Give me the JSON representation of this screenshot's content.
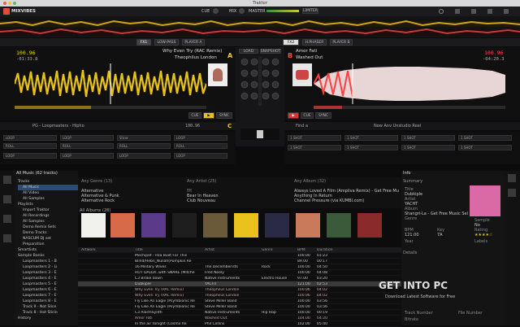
{
  "titlebar": {
    "title": "Traktor"
  },
  "topbar": {
    "logo": "MIXVIBES",
    "cue_label": "CUE",
    "mix_label": "MIX",
    "master_label": "MASTER",
    "limiter_label": "LIMITER"
  },
  "fx": {
    "fx1": "FX1",
    "fx2": "FX2",
    "fx1_effect": "LOW-PASS",
    "fx1_target": "PLAYER A",
    "fx2_effect": "H.PHASER",
    "fx2_target": "PLAYER B"
  },
  "deckA": {
    "title": "Why Even Try (RAC Remix)",
    "artist": "Theophilus London",
    "bpm": "100.96",
    "time_elapsed": "-01:33.8",
    "time_remain": "-01:33.8",
    "letter": "A",
    "cue": "CUE",
    "sync": "SYNC"
  },
  "deckB": {
    "title": "Amor Fati",
    "artist": "Washed Out",
    "bpm": "100.96",
    "time_remain": "-04:20.3",
    "letter": "B",
    "cue": "CUE",
    "sync": "SYNC"
  },
  "mixer": {
    "load": "LOAD",
    "snapshot": "SNAPSHOT",
    "letter_c": "C"
  },
  "deckC": {
    "source": "PG - Loopmasters - Hipho",
    "bpm": "100.96"
  },
  "deckD": {
    "source": "Find a",
    "label": "Now Anv Unstudio Reel"
  },
  "pads": {
    "loop": "LOOP",
    "roll": "ROLL",
    "slicer": "Slicer",
    "one_shot": "1 SHOT"
  },
  "browser": {
    "header": "All Music (62 tracks)",
    "genre_header": "Any Genre (13)",
    "artist_header": "Any Artist (25)",
    "album_header": "Any Album (32)",
    "albums_label": "All Albums (28)",
    "info_header": "Info"
  },
  "tree": [
    "Tracks",
    "All Music",
    "All Video",
    "All Samples",
    "Playlists",
    "Import Traktor",
    "All Recordings",
    "All Samples",
    "Demo Remix Sets",
    "Demo Tracks",
    "NASCUM DJ set",
    "Preparation",
    "Smartlists",
    "Sample Banks",
    "Loopmasters 1 - B",
    "Loopmasters 2 - Li",
    "Loopmasters 3 - E",
    "Loopmasters 4 - E",
    "Loopmasters 5 - E",
    "Loopmasters 6 - E",
    "Loopmasters 7 - E",
    "Loopmasters 8 - E",
    "Track 9 - Not Slice",
    "Track 8 - Hot Slicin",
    "History"
  ],
  "sidebar_icons": [
    "Collection",
    "Music",
    "Explorer",
    "Video",
    "Playlists",
    "Sounds",
    "Timeline",
    "Podcast"
  ],
  "genres": [
    "Alternative",
    "Alternative & Punk",
    "Alternative Rock"
  ],
  "artists": [
    "!!!",
    "Bear In Heaven",
    "Club Nouveau"
  ],
  "albums": [
    "Always Loved A Film (Ampliva Remix) - Get Free Mu",
    "Anything In Return",
    "Channel Pressure (via KUMBI.com)"
  ],
  "columns": {
    "artwork": "Artwork",
    "title": "Title",
    "artist": "Artist",
    "genre": "Genre",
    "bpm": "BPM",
    "duration": "Duration"
  },
  "tracks": [
    {
      "title": "Mochipet - Rza Built For This",
      "artist": "",
      "genre": "",
      "bpm": "100.00",
      "duration": "01:23"
    },
    {
      "title": "Blind/Hebn_Nullah(Pumpkin Re",
      "artist": "",
      "genre": "",
      "bpm": "89.00",
      "duration": "00:17"
    },
    {
      "title": "16 Military Wives",
      "artist": "The Decemberists",
      "genre": "Rock",
      "bpm": "100.00",
      "duration": "04:50"
    },
    {
      "title": "HOT DALUX..with SNARE (Mitche",
      "artist": "Fred Neely",
      "genre": "",
      "bpm": "100.00",
      "duration": "04:08"
    },
    {
      "title": "C3 Broke down",
      "artist": "Native Instruments",
      "genre": "Electro House",
      "bpm": "97.00",
      "duration": "03:20"
    },
    {
      "title": "Dubkiple",
      "artist": "YACHT",
      "genre": "",
      "bpm": "121.00",
      "duration": "02:53"
    },
    {
      "title": "Why Even Try (RAC Remix)",
      "artist": "Theophilus London",
      "genre": "",
      "bpm": "100.96",
      "duration": "04:02"
    },
    {
      "title": "Why Even Try (RAC Remix)",
      "artist": "Theophilus London",
      "genre": "",
      "bpm": "100.96",
      "duration": "04:02"
    },
    {
      "title": "Fly Like An Eagle (Psymbionic Re",
      "artist": "Steve Miller Band",
      "genre": "",
      "bpm": "100.00",
      "duration": "03:56"
    },
    {
      "title": "Fly Like An Eagle (Psymbionic Re",
      "artist": "Steve Miller Band",
      "genre": "",
      "bpm": "100.00",
      "duration": "03:56"
    },
    {
      "title": "C3 AlarmSynth",
      "artist": "Native Instruments",
      "genre": "Hip Hop",
      "bpm": "100.00",
      "duration": "00:19"
    },
    {
      "title": "Amor Fati",
      "artist": "Washed Out",
      "genre": "",
      "bpm": "104.00",
      "duration": "04:20"
    },
    {
      "title": "In the air tonight (Cosmo Re",
      "artist": "Phil Collins",
      "genre": "",
      "bpm": "102.00",
      "duration": "05:40"
    }
  ],
  "info": {
    "summary": "Summary",
    "title_label": "Title",
    "title_value": "Dubkiple",
    "artist_label": "Artist",
    "artist_value": "YACHT",
    "album_label": "Album",
    "album_value": "Shangri-La - Get Free Music Sel &amp;",
    "genre_label": "Genre",
    "sample_label": "Sample",
    "sample_value": "No",
    "bpm_label": "BPM",
    "bpm_value": "121.00",
    "key_label": "Key",
    "key_value": "7A",
    "rating_label": "Rating",
    "year_label": "Year",
    "labels_label": "Labels",
    "details": "Details",
    "track_number_label": "Track Number",
    "file_number_label": "File Number",
    "bitrate_label": "Bitrate"
  },
  "watermark": {
    "main": "GET INTO PC",
    "sub": "Download Latest Software for Free"
  },
  "colors": {
    "deckA": "#f3d11c",
    "deckB": "#ff4a4a",
    "accent": "#e8c21a",
    "bg": "#0c0c0d"
  }
}
